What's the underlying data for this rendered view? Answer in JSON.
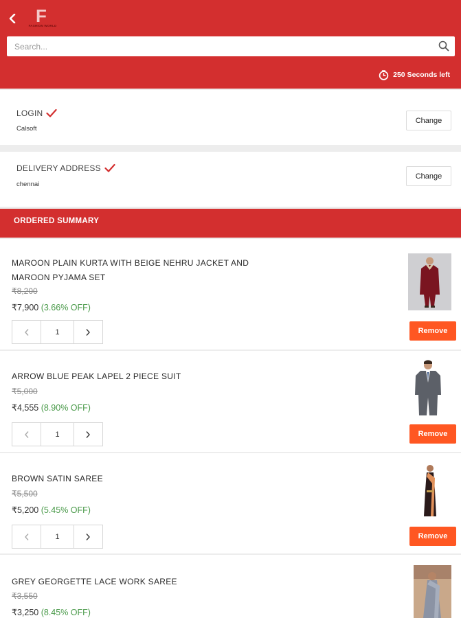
{
  "header": {
    "logo_letter": "F",
    "logo_text": "FASHION WORLD",
    "search_placeholder": "Search...",
    "timer_text": "250  Seconds left"
  },
  "login": {
    "title": "LOGIN",
    "value": "Calsoft",
    "change_label": "Change"
  },
  "delivery": {
    "title": "DELIVERY ADDRESS",
    "value": "chennai",
    "change_label": "Change"
  },
  "summary": {
    "title": "ORDERED SUMMARY"
  },
  "items": [
    {
      "name": "MAROON PLAIN KURTA WITH BEIGE NEHRU JACKET AND MAROON PYJAMA SET",
      "old_price": "₹8,200",
      "new_price": "₹7,900",
      "discount": "(3.66% OFF)",
      "quantity": "1",
      "remove_label": "Remove"
    },
    {
      "name": "ARROW BLUE PEAK LAPEL 2 PIECE SUIT",
      "old_price": "₹5,000",
      "new_price": "₹4,555",
      "discount": "(8.90% OFF)",
      "quantity": "1",
      "remove_label": "Remove"
    },
    {
      "name": "BROWN SATIN SAREE",
      "old_price": "₹5,500",
      "new_price": "₹5,200",
      "discount": "(5.45% OFF)",
      "quantity": "1",
      "remove_label": "Remove"
    },
    {
      "name": "GREY GEORGETTE LACE WORK SAREE",
      "old_price": "₹3,550",
      "new_price": "₹3,250",
      "discount": "(8.45% OFF)"
    }
  ],
  "colors": {
    "brand_red": "#d32f2f",
    "remove_orange": "#ff5722",
    "discount_green": "#4a9a4a"
  },
  "icons": {
    "back": "chevron-left-icon",
    "search": "search-icon",
    "timer": "timer-icon",
    "check": "check-icon",
    "qty_minus": "chevron-left-icon",
    "qty_plus": "chevron-right-icon"
  }
}
